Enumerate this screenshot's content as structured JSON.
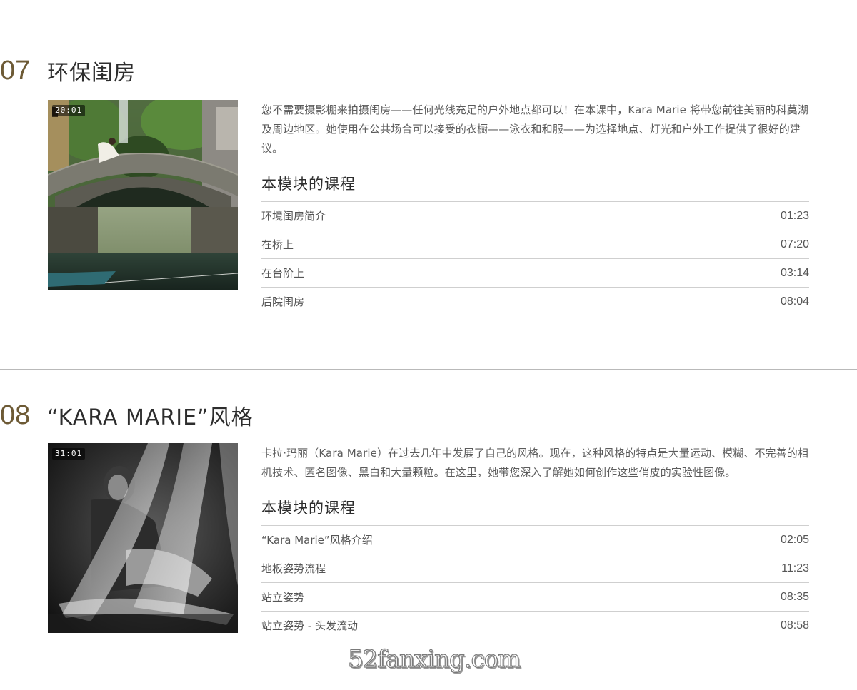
{
  "modules": [
    {
      "number": "07",
      "title": "环保闺房",
      "video_duration": "20:01",
      "description": "您不需要摄影棚来拍摄闺房——任何光线充足的户外地点都可以！在本课中，Kara Marie 将带您前往美丽的科莫湖及周边地区。她使用在公共场合可以接受的衣橱——泳衣和和服——为选择地点、灯光和户外工作提供了很好的建议。",
      "lessons_heading": "本模块的课程",
      "lessons": [
        {
          "title": "环境闺房简介",
          "duration": "01:23"
        },
        {
          "title": "在桥上",
          "duration": "07:20"
        },
        {
          "title": "在台阶上",
          "duration": "03:14"
        },
        {
          "title": "后院闺房",
          "duration": "08:04"
        }
      ]
    },
    {
      "number": "08",
      "title": "“KARA MARIE”风格",
      "video_duration": "31:01",
      "description": "卡拉·玛丽（Kara Marie）在过去几年中发展了自己的风格。现在，这种风格的特点是大量运动、模糊、不完善的相机技术、匿名图像、黑白和大量颗粒。在这里，她带您深入了解她如何创作这些俏皮的实验性图像。",
      "lessons_heading": "本模块的课程",
      "lessons": [
        {
          "title": "“Kara Marie”风格介绍",
          "duration": "02:05"
        },
        {
          "title": "地板姿势流程",
          "duration": "11:23"
        },
        {
          "title": "站立姿势",
          "duration": "08:35"
        },
        {
          "title": "站立姿势 - 头发流动",
          "duration": "08:58"
        }
      ]
    }
  ],
  "watermark": "52fanxing.com",
  "colors": {
    "module_number": "#6d5a35",
    "divider": "#b9b9b9",
    "row_divider": "#cfcfcf",
    "description_text": "#5b5b5b"
  }
}
